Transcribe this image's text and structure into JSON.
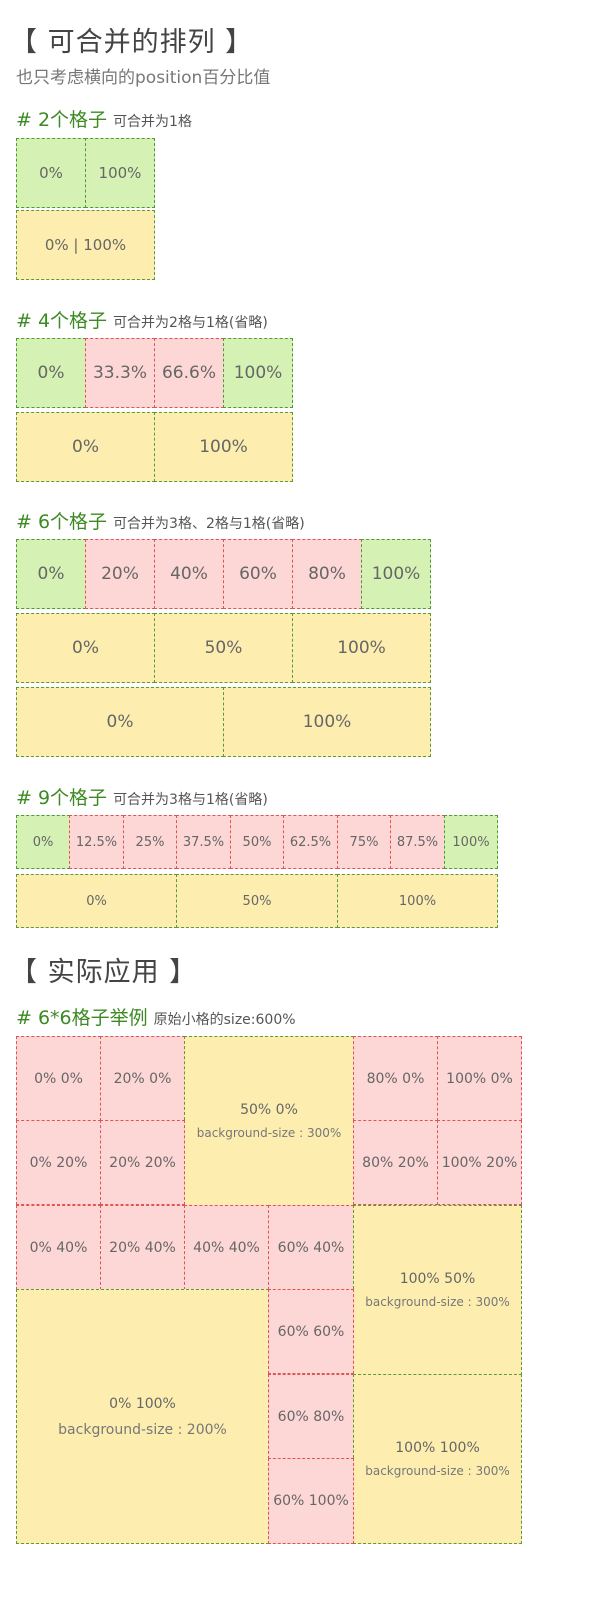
{
  "section1": {
    "title": "【 可合并的排列 】",
    "subtitle": "也只考虑横向的position百分比值"
  },
  "group2": {
    "heading": "# 2个格子",
    "note": "可合并为1格",
    "row1": [
      "0%",
      "100%"
    ],
    "row2": [
      "0% | 100%"
    ]
  },
  "group4": {
    "heading": "# 4个格子",
    "note": "可合并为2格与1格(省略)",
    "row1": [
      "0%",
      "33.3%",
      "66.6%",
      "100%"
    ],
    "row2": [
      "0%",
      "100%"
    ]
  },
  "group6": {
    "heading": "# 6个格子",
    "note": "可合并为3格、2格与1格(省略)",
    "row1": [
      "0%",
      "20%",
      "40%",
      "60%",
      "80%",
      "100%"
    ],
    "row2": [
      "0%",
      "50%",
      "100%"
    ],
    "row3": [
      "0%",
      "100%"
    ]
  },
  "group9": {
    "heading": "# 9个格子",
    "note": "可合并为3格与1格(省略)",
    "row1": [
      "0%",
      "12.5%",
      "25%",
      "37.5%",
      "50%",
      "62.5%",
      "75%",
      "87.5%",
      "100%"
    ],
    "row2": [
      "0%",
      "50%",
      "100%"
    ]
  },
  "section2": {
    "title": "【 实际应用 】"
  },
  "grid66": {
    "heading": "# 6*6格子举例",
    "note": "原始小格的size:600%",
    "cells": {
      "c00": "0% 0%",
      "c10": "20% 0%",
      "c40": "80% 0%",
      "c50": "100% 0%",
      "c01": "0% 20%",
      "c11": "20% 20%",
      "c41": "80% 20%",
      "c51": "100% 20%",
      "c02": "0% 40%",
      "c12": "20% 40%",
      "c22": "40% 40%",
      "c32": "60% 40%",
      "c33": "60% 60%",
      "c34": "60% 80%",
      "c35": "60% 100%"
    },
    "merged": {
      "top_center": {
        "pos": "50% 0%",
        "size": "background-size : 300%"
      },
      "right_middle": {
        "pos": "100% 50%",
        "size": "background-size : 300%"
      },
      "bottom_left": {
        "pos": "0% 100%",
        "size": "background-size : 200%"
      },
      "bottom_right": {
        "pos": "100% 100%",
        "size": "background-size : 300%"
      }
    }
  },
  "colors": {
    "end_cell": "#d5f2b4",
    "middle_cell": "#fdd7d6",
    "merged_cell": "#fdeeb0",
    "heading_green": "#3d8a23"
  }
}
